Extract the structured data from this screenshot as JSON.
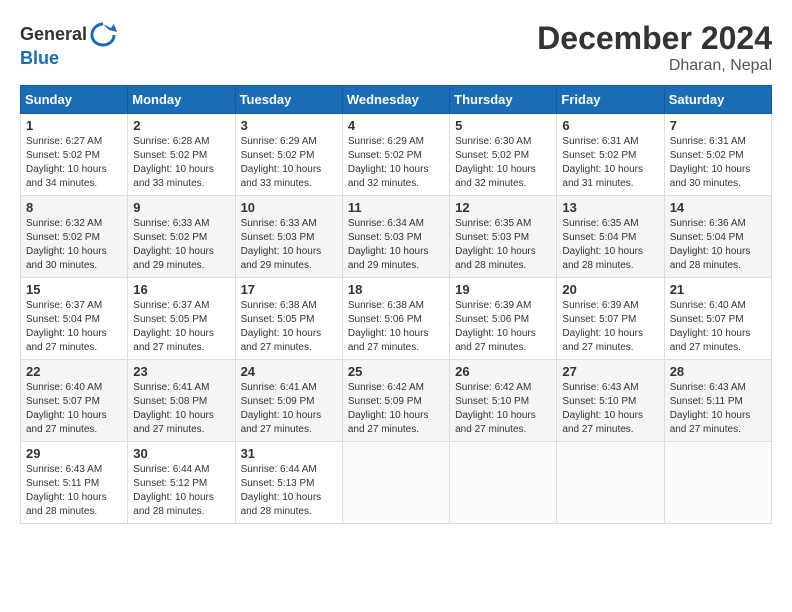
{
  "header": {
    "logo_general": "General",
    "logo_blue": "Blue",
    "month": "December 2024",
    "location": "Dharan, Nepal"
  },
  "weekdays": [
    "Sunday",
    "Monday",
    "Tuesday",
    "Wednesday",
    "Thursday",
    "Friday",
    "Saturday"
  ],
  "weeks": [
    [
      {
        "day": "1",
        "sunrise": "6:27 AM",
        "sunset": "5:02 PM",
        "daylight": "10 hours and 34 minutes."
      },
      {
        "day": "2",
        "sunrise": "6:28 AM",
        "sunset": "5:02 PM",
        "daylight": "10 hours and 33 minutes."
      },
      {
        "day": "3",
        "sunrise": "6:29 AM",
        "sunset": "5:02 PM",
        "daylight": "10 hours and 33 minutes."
      },
      {
        "day": "4",
        "sunrise": "6:29 AM",
        "sunset": "5:02 PM",
        "daylight": "10 hours and 32 minutes."
      },
      {
        "day": "5",
        "sunrise": "6:30 AM",
        "sunset": "5:02 PM",
        "daylight": "10 hours and 32 minutes."
      },
      {
        "day": "6",
        "sunrise": "6:31 AM",
        "sunset": "5:02 PM",
        "daylight": "10 hours and 31 minutes."
      },
      {
        "day": "7",
        "sunrise": "6:31 AM",
        "sunset": "5:02 PM",
        "daylight": "10 hours and 30 minutes."
      }
    ],
    [
      {
        "day": "8",
        "sunrise": "6:32 AM",
        "sunset": "5:02 PM",
        "daylight": "10 hours and 30 minutes."
      },
      {
        "day": "9",
        "sunrise": "6:33 AM",
        "sunset": "5:02 PM",
        "daylight": "10 hours and 29 minutes."
      },
      {
        "day": "10",
        "sunrise": "6:33 AM",
        "sunset": "5:03 PM",
        "daylight": "10 hours and 29 minutes."
      },
      {
        "day": "11",
        "sunrise": "6:34 AM",
        "sunset": "5:03 PM",
        "daylight": "10 hours and 29 minutes."
      },
      {
        "day": "12",
        "sunrise": "6:35 AM",
        "sunset": "5:03 PM",
        "daylight": "10 hours and 28 minutes."
      },
      {
        "day": "13",
        "sunrise": "6:35 AM",
        "sunset": "5:04 PM",
        "daylight": "10 hours and 28 minutes."
      },
      {
        "day": "14",
        "sunrise": "6:36 AM",
        "sunset": "5:04 PM",
        "daylight": "10 hours and 28 minutes."
      }
    ],
    [
      {
        "day": "15",
        "sunrise": "6:37 AM",
        "sunset": "5:04 PM",
        "daylight": "10 hours and 27 minutes."
      },
      {
        "day": "16",
        "sunrise": "6:37 AM",
        "sunset": "5:05 PM",
        "daylight": "10 hours and 27 minutes."
      },
      {
        "day": "17",
        "sunrise": "6:38 AM",
        "sunset": "5:05 PM",
        "daylight": "10 hours and 27 minutes."
      },
      {
        "day": "18",
        "sunrise": "6:38 AM",
        "sunset": "5:06 PM",
        "daylight": "10 hours and 27 minutes."
      },
      {
        "day": "19",
        "sunrise": "6:39 AM",
        "sunset": "5:06 PM",
        "daylight": "10 hours and 27 minutes."
      },
      {
        "day": "20",
        "sunrise": "6:39 AM",
        "sunset": "5:07 PM",
        "daylight": "10 hours and 27 minutes."
      },
      {
        "day": "21",
        "sunrise": "6:40 AM",
        "sunset": "5:07 PM",
        "daylight": "10 hours and 27 minutes."
      }
    ],
    [
      {
        "day": "22",
        "sunrise": "6:40 AM",
        "sunset": "5:07 PM",
        "daylight": "10 hours and 27 minutes."
      },
      {
        "day": "23",
        "sunrise": "6:41 AM",
        "sunset": "5:08 PM",
        "daylight": "10 hours and 27 minutes."
      },
      {
        "day": "24",
        "sunrise": "6:41 AM",
        "sunset": "5:09 PM",
        "daylight": "10 hours and 27 minutes."
      },
      {
        "day": "25",
        "sunrise": "6:42 AM",
        "sunset": "5:09 PM",
        "daylight": "10 hours and 27 minutes."
      },
      {
        "day": "26",
        "sunrise": "6:42 AM",
        "sunset": "5:10 PM",
        "daylight": "10 hours and 27 minutes."
      },
      {
        "day": "27",
        "sunrise": "6:43 AM",
        "sunset": "5:10 PM",
        "daylight": "10 hours and 27 minutes."
      },
      {
        "day": "28",
        "sunrise": "6:43 AM",
        "sunset": "5:11 PM",
        "daylight": "10 hours and 27 minutes."
      }
    ],
    [
      {
        "day": "29",
        "sunrise": "6:43 AM",
        "sunset": "5:11 PM",
        "daylight": "10 hours and 28 minutes."
      },
      {
        "day": "30",
        "sunrise": "6:44 AM",
        "sunset": "5:12 PM",
        "daylight": "10 hours and 28 minutes."
      },
      {
        "day": "31",
        "sunrise": "6:44 AM",
        "sunset": "5:13 PM",
        "daylight": "10 hours and 28 minutes."
      },
      null,
      null,
      null,
      null
    ]
  ]
}
